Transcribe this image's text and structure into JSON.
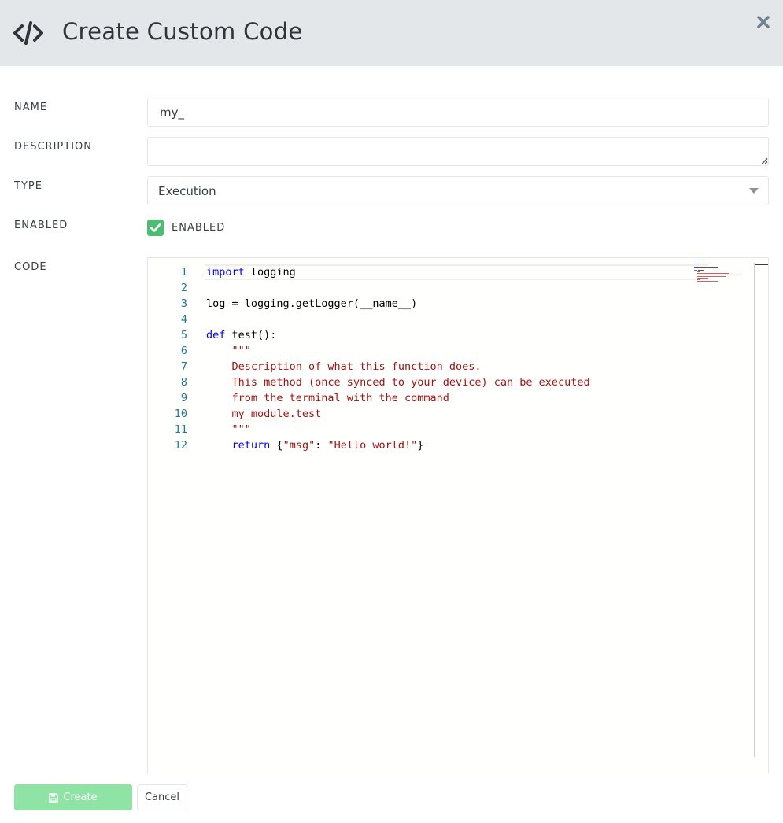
{
  "header": {
    "icon": "code-icon",
    "title": "Create Custom Code",
    "close_icon": "close-icon"
  },
  "form": {
    "name": {
      "label": "NAME",
      "value": "my_"
    },
    "description": {
      "label": "DESCRIPTION",
      "value": ""
    },
    "type": {
      "label": "TYPE",
      "value": "Execution"
    },
    "enabled": {
      "label": "ENABLED",
      "checkbox_label": "ENABLED",
      "checked": true
    },
    "code": {
      "label": "CODE"
    }
  },
  "editor": {
    "line_numbers": [
      "1",
      "2",
      "3",
      "4",
      "5",
      "6",
      "7",
      "8",
      "9",
      "10",
      "11",
      "12"
    ],
    "lines": [
      [
        {
          "t": "import",
          "c": "kw"
        },
        {
          "t": " logging",
          "c": ""
        }
      ],
      [],
      [
        {
          "t": "log = logging.getLogger(__name__)",
          "c": ""
        }
      ],
      [],
      [
        {
          "t": "def",
          "c": "kw"
        },
        {
          "t": " test():",
          "c": ""
        }
      ],
      [
        {
          "t": "    \"\"\"",
          "c": "str"
        }
      ],
      [
        {
          "t": "    Description of what this function does.",
          "c": "str"
        }
      ],
      [
        {
          "t": "    This method (once synced to your device) can be executed",
          "c": "str"
        }
      ],
      [
        {
          "t": "    from the terminal with the command",
          "c": "str"
        }
      ],
      [
        {
          "t": "    my_module.test",
          "c": "str"
        }
      ],
      [
        {
          "t": "    \"\"\"",
          "c": "str"
        }
      ],
      [
        {
          "t": "    ",
          "c": ""
        },
        {
          "t": "return",
          "c": "kw"
        },
        {
          "t": " {",
          "c": ""
        },
        {
          "t": "\"msg\"",
          "c": "str"
        },
        {
          "t": ": ",
          "c": ""
        },
        {
          "t": "\"Hello world!\"",
          "c": "str"
        },
        {
          "t": "}",
          "c": ""
        }
      ]
    ]
  },
  "actions": {
    "create_label": "Create",
    "create_icon": "save-icon",
    "cancel_label": "Cancel"
  },
  "colors": {
    "header_bg": "#e4e7ea",
    "success": "#4dbd74",
    "create_disabled": "#8fe3a4",
    "keyword": "#0000ff",
    "string": "#a31515",
    "line_number": "#237893"
  }
}
